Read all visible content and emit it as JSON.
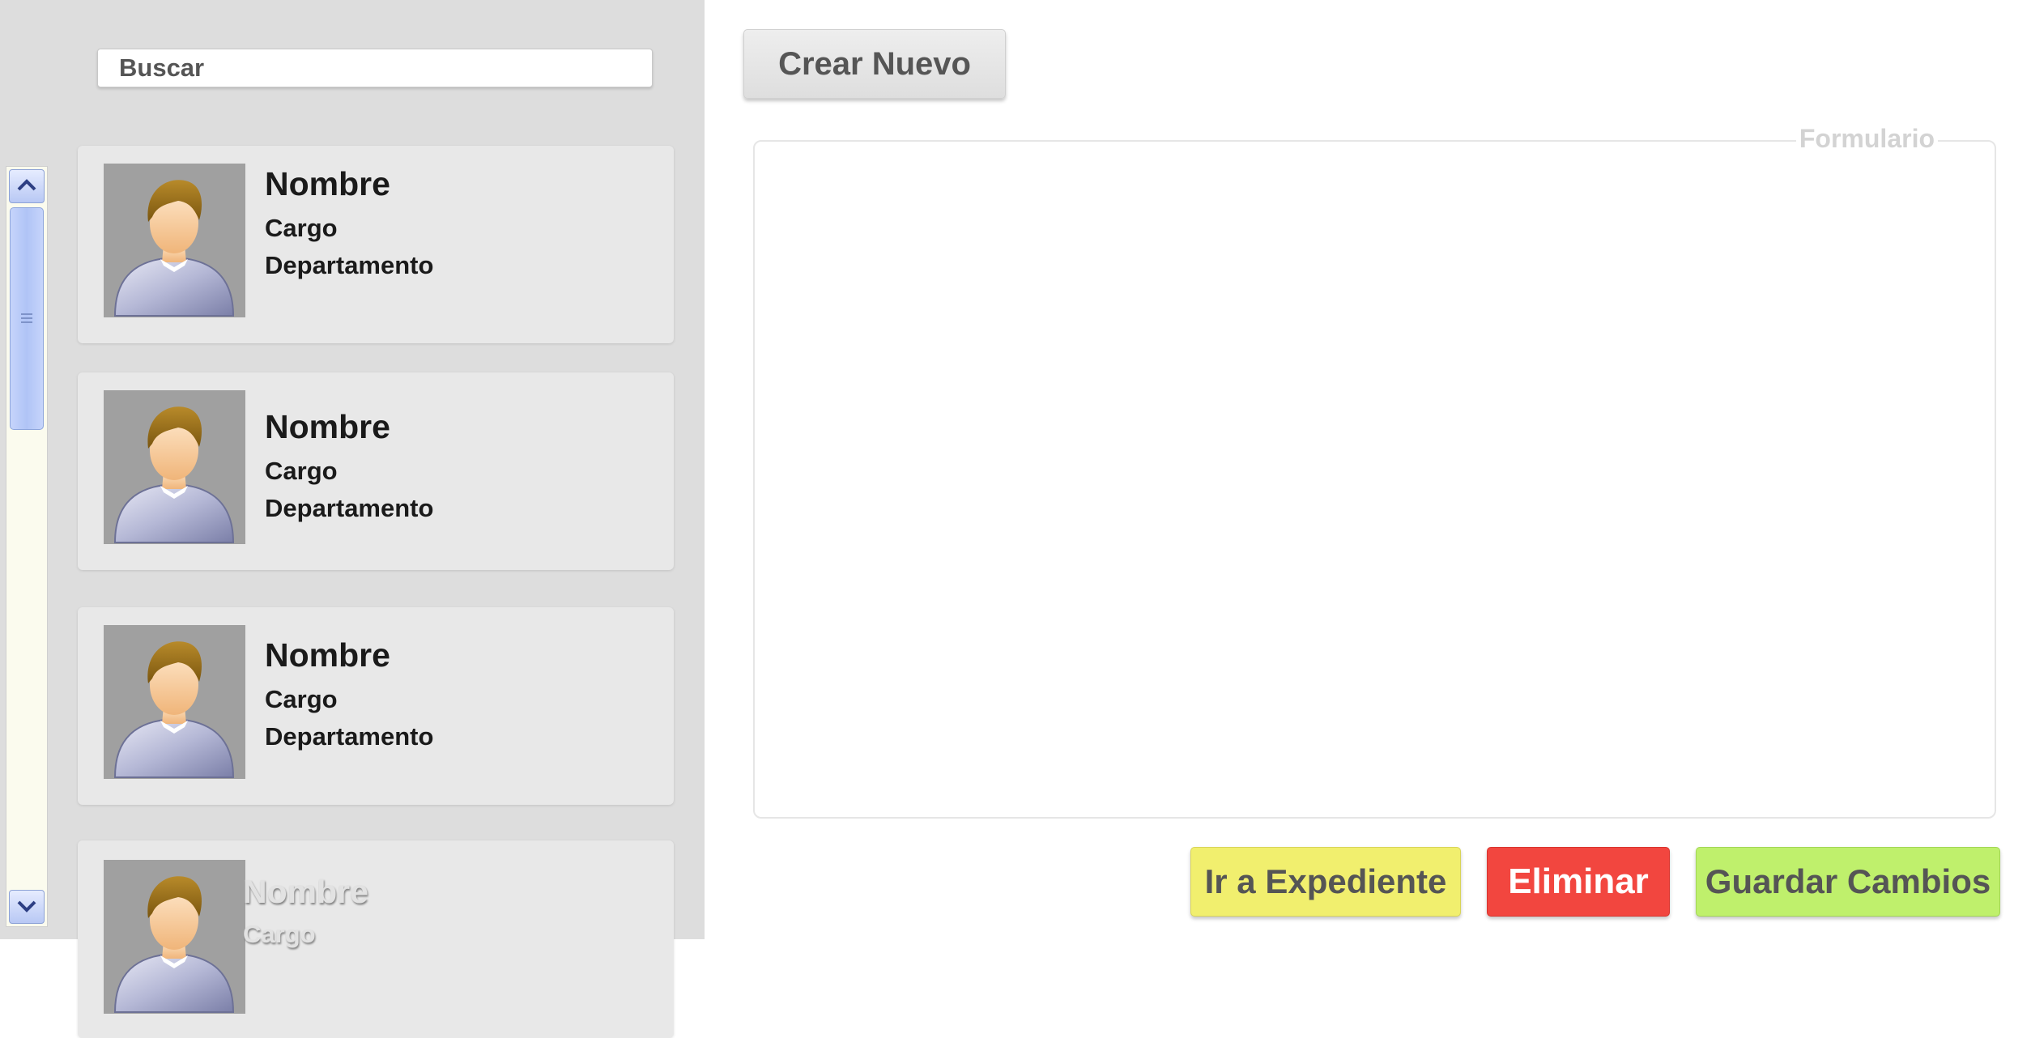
{
  "search": {
    "placeholder": "Buscar"
  },
  "employees": [
    {
      "name": "Nombre",
      "role": "Cargo",
      "department": "Departamento"
    },
    {
      "name": "Nombre",
      "role": "Cargo",
      "department": "Departamento"
    },
    {
      "name": "Nombre",
      "role": "Cargo",
      "department": "Departamento"
    },
    {
      "name": "Nombre",
      "role": "Cargo"
    }
  ],
  "toolbar": {
    "create_label": "Crear Nuevo"
  },
  "form": {
    "legend": "Formulario"
  },
  "actions": {
    "expediente_label": "Ir a Expediente",
    "delete_label": "Eliminar",
    "save_label": "Guardar Cambios"
  },
  "colors": {
    "panel_bg": "#dddddd",
    "card_bg": "#e8e8e8",
    "expediente": "#f1ef6e",
    "delete": "#f2463f",
    "save": "#bff06c"
  },
  "icons": {
    "avatar": "user-avatar-icon",
    "scroll_up": "chevron-up-icon",
    "scroll_down": "chevron-down-icon"
  }
}
